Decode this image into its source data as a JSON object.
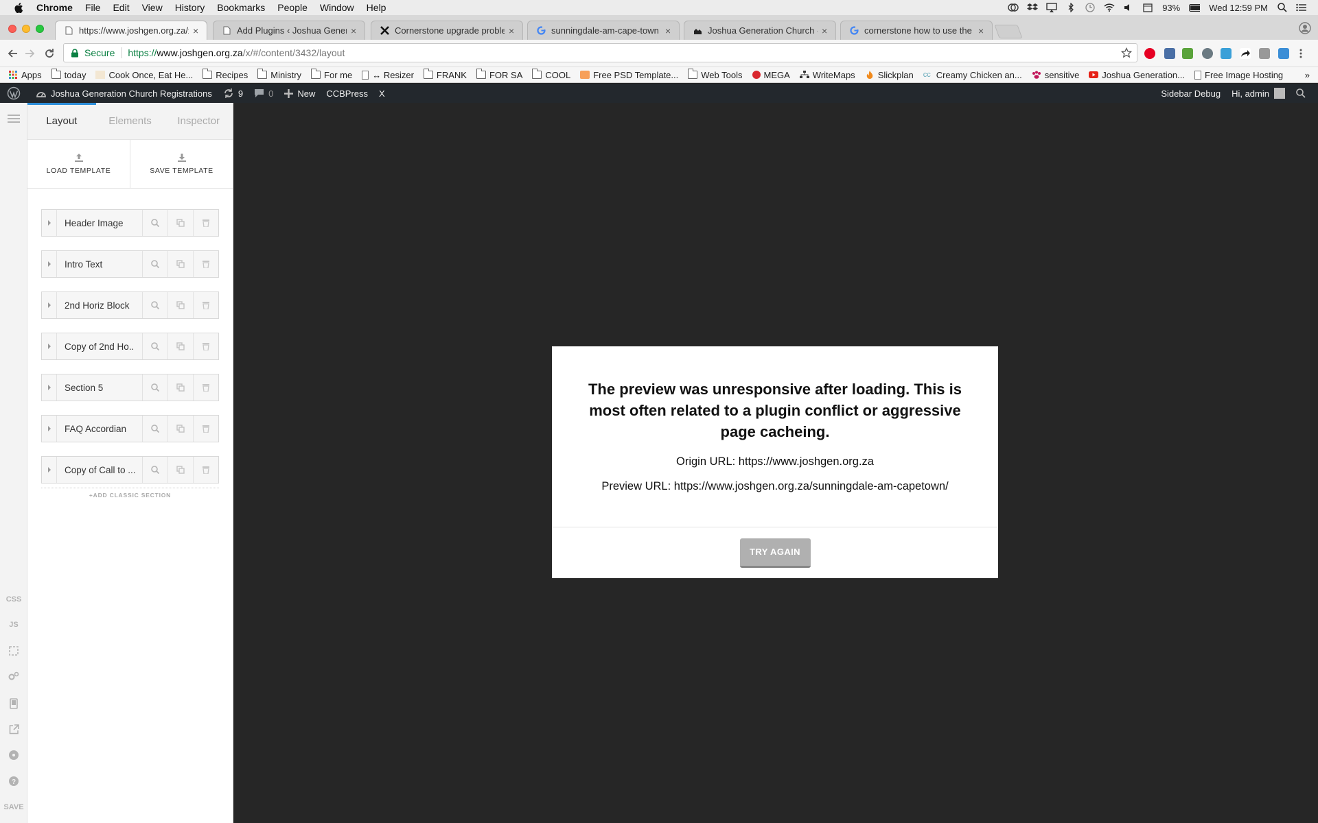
{
  "menubar": {
    "app": "Chrome",
    "items": [
      "File",
      "Edit",
      "View",
      "History",
      "Bookmarks",
      "People",
      "Window",
      "Help"
    ],
    "battery": "93%",
    "clock": "Wed 12:59 PM"
  },
  "tabs": [
    {
      "title": "https://www.joshgen.org.za/x/#/",
      "active": true,
      "icon": "page-icon"
    },
    {
      "title": "Add Plugins ‹ Joshua Generati",
      "active": false,
      "icon": "page-icon"
    },
    {
      "title": "Cornerstone upgrade problem",
      "active": false,
      "icon": "x-icon"
    },
    {
      "title": "sunningdale-am-cape-town - G",
      "active": false,
      "icon": "google-icon"
    },
    {
      "title": "Joshua Generation Church - S",
      "active": false,
      "icon": "church-icon"
    },
    {
      "title": "cornerstone how to use the qu",
      "active": false,
      "icon": "google-icon"
    }
  ],
  "omnibox": {
    "secure_label": "Secure",
    "url_scheme": "https://",
    "url_host": "www.joshgen.org.za",
    "url_path": "/x/#/content/3432/layout"
  },
  "bookmarks": {
    "items": [
      {
        "label": "Apps",
        "icon": "apps-grid-icon"
      },
      {
        "label": "today",
        "icon": "folder-icon"
      },
      {
        "label": "Cook Once, Eat He...",
        "icon": "site-icon"
      },
      {
        "label": "Recipes",
        "icon": "folder-icon"
      },
      {
        "label": "Ministry",
        "icon": "folder-icon"
      },
      {
        "label": "For me",
        "icon": "folder-icon"
      },
      {
        "label": "↔ Resizer",
        "icon": "page-icon"
      },
      {
        "label": "FRANK",
        "icon": "folder-icon"
      },
      {
        "label": "FOR SA",
        "icon": "folder-icon"
      },
      {
        "label": "COOL",
        "icon": "folder-icon"
      },
      {
        "label": "Free PSD Template...",
        "icon": "site-icon"
      },
      {
        "label": "Web Tools",
        "icon": "folder-icon"
      },
      {
        "label": "MEGA",
        "icon": "mega-icon"
      },
      {
        "label": "WriteMaps",
        "icon": "sitemap-icon"
      },
      {
        "label": "Slickplan",
        "icon": "flame-icon"
      },
      {
        "label": "Creamy Chicken an...",
        "icon": "cc-icon"
      },
      {
        "label": "sensitive",
        "icon": "paw-icon"
      },
      {
        "label": "Joshua Generation...",
        "icon": "youtube-icon"
      },
      {
        "label": "Free Image Hosting",
        "icon": "page-icon"
      }
    ],
    "more": "»"
  },
  "wpbar": {
    "site_name": "Joshua Generation Church Registrations",
    "updates_count": "9",
    "comments_count": "0",
    "new_label": "New",
    "ccbpress_label": "CCBPress",
    "x_label": "X",
    "sidebar_debug": "Sidebar Debug",
    "greeting": "Hi, admin"
  },
  "rail": {
    "css": "CSS",
    "js": "JS",
    "save": "SAVE"
  },
  "panel": {
    "tabs": [
      "Layout",
      "Elements",
      "Inspector"
    ],
    "load_template": "LOAD TEMPLATE",
    "save_template": "SAVE TEMPLATE",
    "sections": [
      "Header Image",
      "Intro Text",
      "2nd Horiz Block",
      "Copy of 2nd Ho..",
      "Section 5",
      "FAQ Accordian",
      "Copy of Call to ..."
    ],
    "add_classic": "+ADD CLASSIC SECTION"
  },
  "modal": {
    "message": "The preview was unresponsive after loading. This is most often related to a plugin conflict or aggressive page cacheing.",
    "origin": "Origin URL: https://www.joshgen.org.za",
    "preview": "Preview URL: https://www.joshgen.org.za/sunningdale-am-capetown/",
    "button": "TRY AGAIN"
  },
  "colors": {
    "wp_bar": "#23282d",
    "accent": "#2d8ed9",
    "secure_green": "#0b8043",
    "preview_bg": "#262626"
  }
}
